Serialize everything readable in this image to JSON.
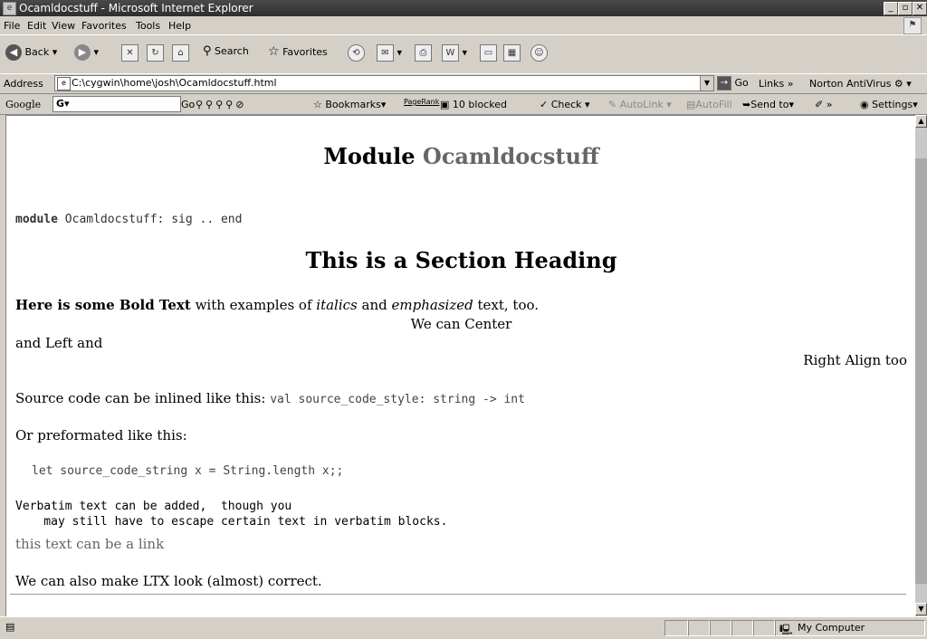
{
  "window": {
    "title": "Ocamldocstuff - Microsoft Internet Explorer"
  },
  "menu": [
    "File",
    "Edit",
    "View",
    "Favorites",
    "Tools",
    "Help"
  ],
  "toolbar": {
    "back": "Back",
    "search": "Search",
    "favorites": "Favorites"
  },
  "address": {
    "label": "Address",
    "url": "C:\\cygwin\\home\\josh\\Ocamldocstuff.html",
    "go": "Go",
    "links": "Links",
    "norton": "Norton AntiVirus"
  },
  "google": {
    "logo": "Google",
    "go": "Go",
    "bookmarks": "Bookmarks",
    "pagerank": "PageRank",
    "blocked": "10 blocked",
    "check": "Check",
    "autolink": "AutoLink",
    "autofill": "AutoFill",
    "sendto": "Send to",
    "settings": "Settings"
  },
  "page": {
    "title_prefix": "Module",
    "title_name": "Ocamldocstuff",
    "sig_keyword": "module",
    "sig_rest": "Ocamldocstuff: sig .. end",
    "section_heading": "This is a Section Heading",
    "bold": "Here is some Bold Text",
    "with_examples": "with examples of",
    "italics": "italics",
    "and": "and",
    "emphasized": "emphasized",
    "text_too": "text, too.",
    "center": "We can Center",
    "left": "and Left and",
    "right": "Right Align too",
    "inline_intro": "Source code can be inlined like this:",
    "inline_code": "val source_code_style: string -> int",
    "pre_intro": "Or preformated like this:",
    "pre_code": "let source_code_string x = String.length x;;",
    "verbatim1": "Verbatim text can be added,  though you",
    "verbatim2": "    may still have to escape certain text in verbatim blocks.",
    "link": "this text can be a link",
    "latex": "We can also make LTX look (almost) correct."
  },
  "status": {
    "zone": "My Computer"
  }
}
